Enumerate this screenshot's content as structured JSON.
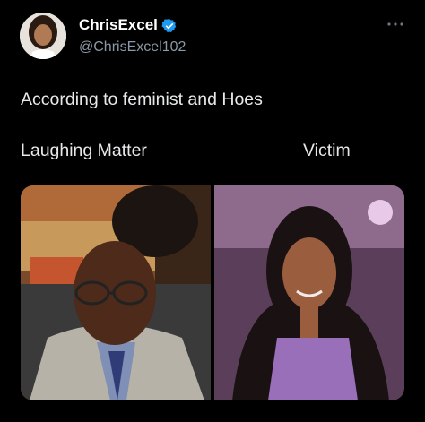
{
  "tweet": {
    "display_name": "ChrisExcel",
    "handle": "@ChrisExcel102",
    "text": "According to feminist and Hoes",
    "label_left": "Laughing Matter",
    "label_right": "Victim"
  },
  "colors": {
    "background": "#000000",
    "text_primary": "#e7e9ea",
    "text_secondary": "#8b98a5",
    "verified_blue": "#1d9bf0"
  },
  "icons": {
    "verified": "verified-badge-icon",
    "more": "more-options-icon"
  }
}
